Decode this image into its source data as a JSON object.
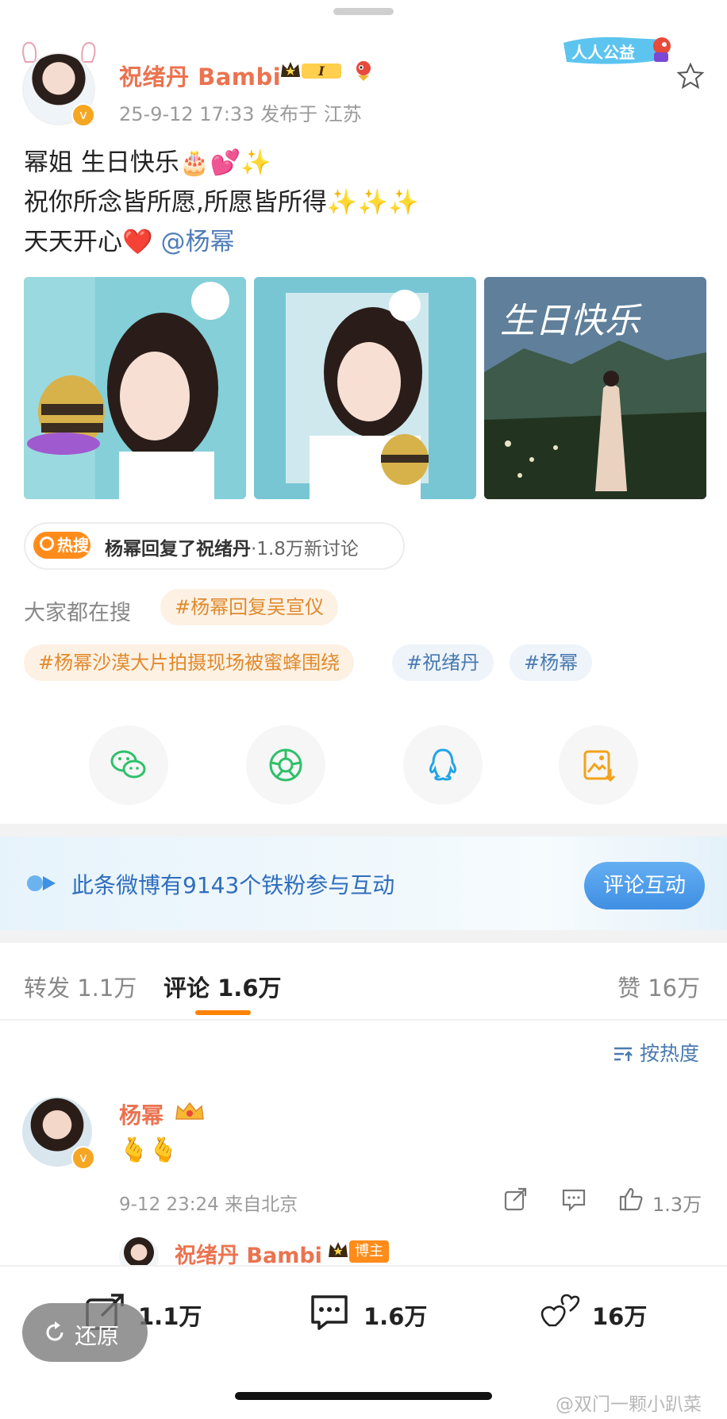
{
  "post": {
    "author": "祝绪丹 Bambi",
    "rank_badge": "I",
    "time_location": "25-9-12 17:33  发布于 江苏",
    "gongyi_label": "人人公益",
    "lines": [
      "幂姐 生日快乐🎂💕✨",
      "祝你所念皆所愿,所愿皆所得✨✨✨",
      "天天开心❤️"
    ],
    "mention": "@杨幂",
    "image3_overlay": "生日快乐"
  },
  "hot_search": {
    "logo": "热搜",
    "text": "杨幂回复了祝绪丹",
    "count": "·1.8万新讨论"
  },
  "everyone_searching": {
    "label": "大家都在搜",
    "tags": [
      "#杨幂回复吴宣仪",
      "#杨幂沙漠大片拍摄现场被蜜蜂围绕",
      "#祝绪丹",
      "#杨幂"
    ]
  },
  "banner": {
    "text": "此条微博有9143个铁粉参与互动",
    "button": "评论互动"
  },
  "tabs": {
    "repost_label": "转发",
    "repost_count": "1.1万",
    "comment_label": "评论",
    "comment_count": "1.6万",
    "like_label": "赞",
    "like_count": "16万",
    "sort": "按热度"
  },
  "comment": {
    "name": "杨幂",
    "body": "🫰🫰",
    "meta": "9-12 23:24  来自北京",
    "likes": "1.3万",
    "reply_name": "祝绪丹 Bambi",
    "reply_badge": "博主"
  },
  "bottom_bar": {
    "repost_count": "1.1万",
    "comment_count": "1.6万",
    "like_count": "16万",
    "restore": "还原"
  },
  "watermark": "@双门一颗小趴菜",
  "colors": {
    "username": "#eb7350",
    "accent_orange": "#ff8200",
    "link_blue": "#4a7ab0",
    "banner_button": "#3f8fe3"
  },
  "icons": [
    "wechat-icon",
    "moments-icon",
    "qq-icon",
    "save-image-icon",
    "star-icon",
    "repost-icon",
    "comment-icon",
    "like-icon",
    "restore-icon"
  ]
}
